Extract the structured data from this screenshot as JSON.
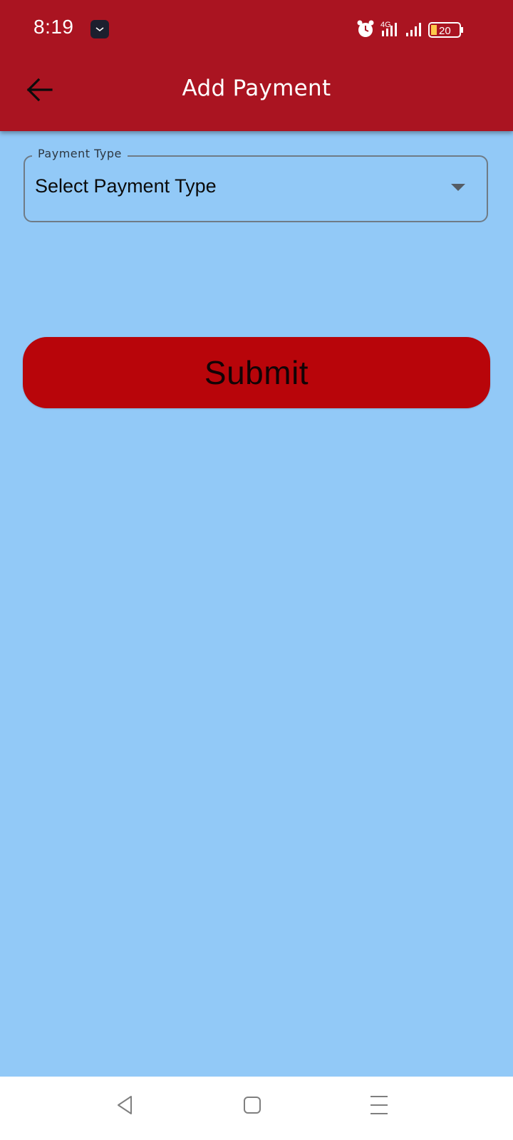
{
  "status_bar": {
    "time": "8:19",
    "network_label": "4G",
    "battery_level": "20",
    "icons": [
      "app-notification-icon",
      "alarm-icon",
      "signal-4g-icon",
      "signal-icon",
      "battery-icon"
    ]
  },
  "app_bar": {
    "title": "Add Payment",
    "back_icon": "arrow-left-icon"
  },
  "form": {
    "payment_type": {
      "label": "Payment Type",
      "value": "Select Payment Type",
      "icon": "dropdown-arrow-icon"
    },
    "submit_label": "Submit"
  },
  "colors": {
    "header": "#aa1421",
    "background": "#92c9f7",
    "submit_button": "#b8050a",
    "field_border": "#6f7b86"
  },
  "nav_bar": {
    "icons": [
      "back-triangle-icon",
      "home-square-icon",
      "menu-lines-icon"
    ]
  }
}
